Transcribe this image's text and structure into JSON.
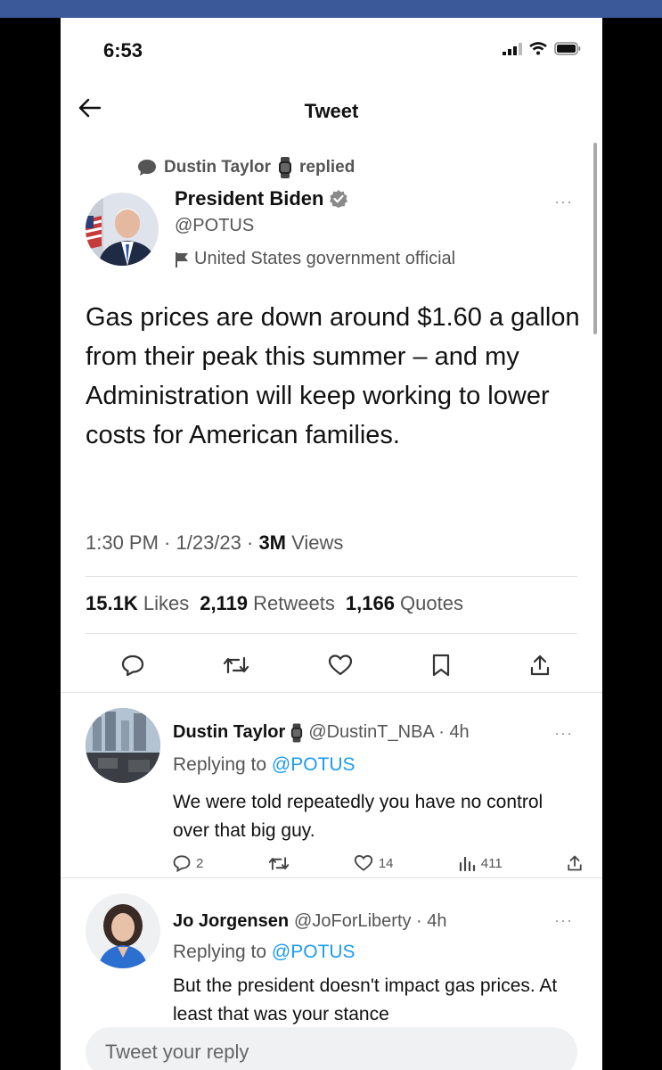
{
  "status_bar": {
    "time": "6:53"
  },
  "nav": {
    "title": "Tweet"
  },
  "social_context": {
    "name": "Dustin Taylor",
    "action": "replied"
  },
  "tweet": {
    "author_name": "President Biden",
    "handle": "@POTUS",
    "label": "United States government official",
    "text": "Gas prices are down around $1.60 a gallon from their peak this summer – and my Administration will keep working to lower costs for American families.",
    "time": "1:30 PM · 1/23/23 · ",
    "views_count": "3M",
    "views_label": " Views",
    "likes_count": "15.1K",
    "likes_label": " Likes",
    "retweets_count": "2,119",
    "retweets_label": " Retweets",
    "quotes_count": "1,166",
    "quotes_label": " Quotes"
  },
  "replies": [
    {
      "name": "Dustin Taylor",
      "handle": "@DustinT_NBA · 4h",
      "replying_prefix": "Replying to ",
      "replying_to": "@POTUS",
      "text": "We were told repeatedly you have no control over that big guy.",
      "reply_count": "2",
      "like_count": "14",
      "view_count": "411"
    },
    {
      "name": "Jo Jorgensen",
      "handle": "@JoForLiberty · 4h",
      "replying_prefix": "Replying to ",
      "replying_to": "@POTUS",
      "text": "But the president doesn't impact gas prices. At least that was your stance"
    }
  ],
  "compose": {
    "placeholder": "Tweet your reply"
  },
  "colors": {
    "link": "#1d9bf0",
    "verified": "#8a8a8a",
    "muted": "#555555",
    "topbar": "#3b5998"
  }
}
